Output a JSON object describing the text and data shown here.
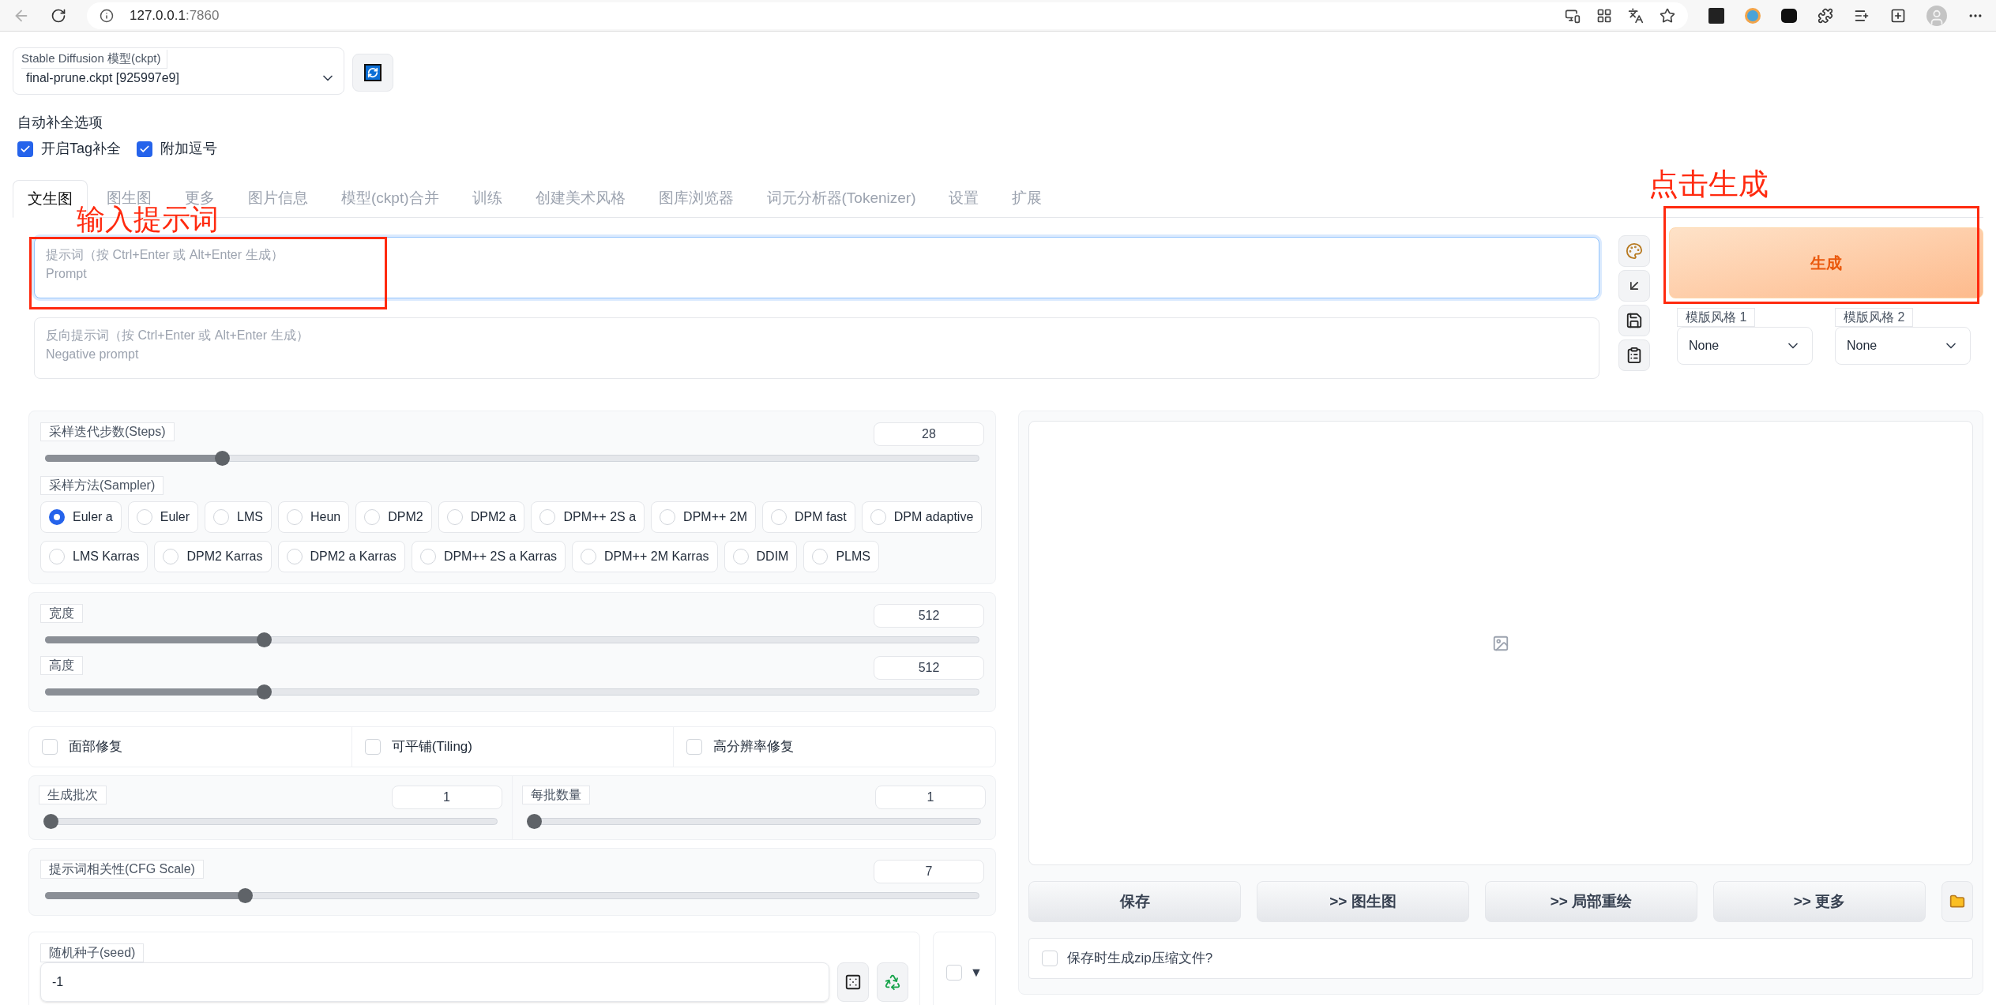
{
  "browser": {
    "host": "127.0.0.1",
    "port": ":7860"
  },
  "model": {
    "label": "Stable Diffusion 模型(ckpt)",
    "value": "final-prune.ckpt [925997e9]"
  },
  "autocomplete": {
    "title": "自动补全选项",
    "options": [
      {
        "label": "开启Tag补全",
        "checked": true
      },
      {
        "label": "附加逗号",
        "checked": true
      }
    ]
  },
  "tabs": [
    {
      "label": "文生图",
      "selected": true
    },
    {
      "label": "图生图",
      "selected": false
    },
    {
      "label": "更多",
      "selected": false
    },
    {
      "label": "图片信息",
      "selected": false
    },
    {
      "label": "模型(ckpt)合并",
      "selected": false
    },
    {
      "label": "训练",
      "selected": false
    },
    {
      "label": "创建美术风格",
      "selected": false
    },
    {
      "label": "图库浏览器",
      "selected": false
    },
    {
      "label": "词元分析器(Tokenizer)",
      "selected": false
    },
    {
      "label": "设置",
      "selected": false
    },
    {
      "label": "扩展",
      "selected": false
    }
  ],
  "prompt": {
    "placeholder": "提示词（按 Ctrl+Enter 或 Alt+Enter 生成）\nPrompt"
  },
  "negative_prompt": {
    "placeholder": "反向提示词（按 Ctrl+Enter 或 Alt+Enter 生成）\nNegative prompt"
  },
  "generate_button": "生成",
  "styles": [
    {
      "label": "模版风格 1",
      "value": "None"
    },
    {
      "label": "模版风格 2",
      "value": "None"
    }
  ],
  "steps": {
    "label": "采样迭代步数(Steps)",
    "value": "28",
    "level": 0.185
  },
  "sampler": {
    "label": "采样方法(Sampler)",
    "options": [
      {
        "label": "Euler a",
        "selected": true
      },
      {
        "label": "Euler",
        "selected": false
      },
      {
        "label": "LMS",
        "selected": false
      },
      {
        "label": "Heun",
        "selected": false
      },
      {
        "label": "DPM2",
        "selected": false
      },
      {
        "label": "DPM2 a",
        "selected": false
      },
      {
        "label": "DPM++ 2S a",
        "selected": false
      },
      {
        "label": "DPM++ 2M",
        "selected": false
      },
      {
        "label": "DPM fast",
        "selected": false
      },
      {
        "label": "DPM adaptive",
        "selected": false
      },
      {
        "label": "LMS Karras",
        "selected": false
      },
      {
        "label": "DPM2 Karras",
        "selected": false
      },
      {
        "label": "DPM2 a Karras",
        "selected": false
      },
      {
        "label": "DPM++ 2S a Karras",
        "selected": false
      },
      {
        "label": "DPM++ 2M Karras",
        "selected": false
      },
      {
        "label": "DDIM",
        "selected": false
      },
      {
        "label": "PLMS",
        "selected": false
      }
    ]
  },
  "width": {
    "label": "宽度",
    "value": "512",
    "level": 0.23
  },
  "height": {
    "label": "高度",
    "value": "512",
    "level": 0.23
  },
  "toggles": [
    {
      "label": "面部修复",
      "checked": false
    },
    {
      "label": "可平铺(Tiling)",
      "checked": false
    },
    {
      "label": "高分辨率修复",
      "checked": false
    }
  ],
  "batch_count": {
    "label": "生成批次",
    "value": "1",
    "level": 0
  },
  "batch_size": {
    "label": "每批数量",
    "value": "1",
    "level": 0
  },
  "cfg": {
    "label": "提示词相关性(CFG Scale)",
    "value": "7",
    "level": 0.21
  },
  "seed": {
    "label": "随机种子(seed)",
    "value": "-1"
  },
  "extra_seed": {
    "checked": false,
    "arrow": "▼"
  },
  "output_actions": [
    "保存",
    ">> 图生图",
    ">> 局部重绘",
    ">> 更多"
  ],
  "zip_option": {
    "label": "保存时生成zip压缩文件?",
    "checked": false
  },
  "annotations": [
    {
      "text": "输入提示词"
    },
    {
      "text": "点击生成"
    }
  ]
}
